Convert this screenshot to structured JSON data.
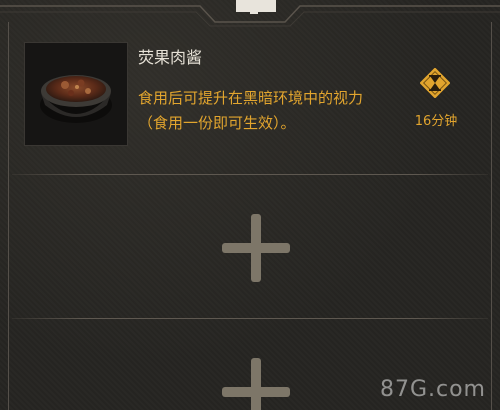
{
  "food": {
    "name": "荧果肉酱",
    "description": "食用后可提升在黑暗环境中的视力（食用一份即可生效）。",
    "duration": "16分钟",
    "icon": "hourglass-icon"
  },
  "slots": [
    {
      "icon": "plus-icon"
    },
    {
      "icon": "plus-icon"
    }
  ],
  "watermark": "87G.com",
  "colors": {
    "accent": "#e2a52e",
    "title": "#e6e1d6",
    "background": "#262522"
  }
}
